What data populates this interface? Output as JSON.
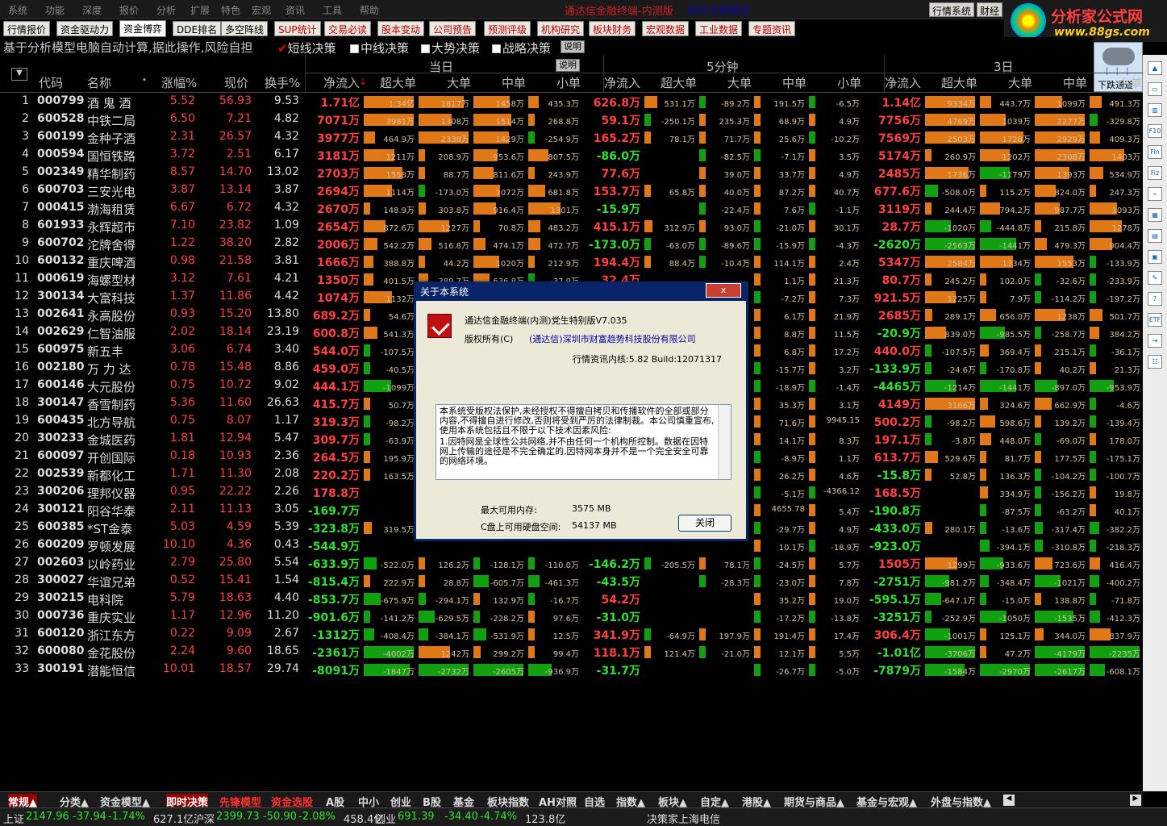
{
  "menu": [
    "系统",
    "功能",
    "深度",
    "报价",
    "分析",
    "扩展",
    "特色",
    "宏观",
    "资讯",
    "工具",
    "帮助"
  ],
  "app_title": "通达信金融终端-内测版",
  "mode_title": "即时决策模型",
  "top_buttons": [
    "行情系统",
    "财经"
  ],
  "logo": {
    "main": "分析家公式网",
    "url": "www.88gs.com"
  },
  "tabs": [
    {
      "label": "行情报价",
      "red": false
    },
    {
      "label": "资金驱动力",
      "red": false
    },
    {
      "label": "资金博弈",
      "red": false
    },
    {
      "label": "DDE排名",
      "red": false
    },
    {
      "label": "多空阵线",
      "red": false
    },
    {
      "label": "SUP统计",
      "red": true
    },
    {
      "label": "交易必读",
      "red": true
    },
    {
      "label": "股本变动",
      "red": true
    },
    {
      "label": "公司预告",
      "red": true
    },
    {
      "label": "预测评级",
      "red": true
    },
    {
      "label": "机构研究",
      "red": true
    },
    {
      "label": "板块财务",
      "red": true
    },
    {
      "label": "宏观数据",
      "red": true
    },
    {
      "label": "工业数据",
      "red": true
    },
    {
      "label": "专题资讯",
      "red": true
    }
  ],
  "notice": {
    "message": "基于分析模型电脑自动计算,据此操作,风险自担",
    "options": [
      {
        "label": "短线决策",
        "checked": true
      },
      {
        "label": "中线决策",
        "checked": false
      },
      {
        "label": "大势决策",
        "checked": false
      },
      {
        "label": "战略决策",
        "checked": false
      }
    ],
    "explain": "说明"
  },
  "weather_label": "下跌通道",
  "groups": {
    "today": "当日",
    "min5": "5分钟",
    "day3": "3日",
    "explain": "说明"
  },
  "cols": {
    "code": "代码",
    "name": "名称",
    "chg": "涨幅%",
    "price": "现价",
    "turn": "换手%",
    "net": "净流入",
    "super": "超大单",
    "large": "大单",
    "mid": "中单",
    "small": "小单"
  },
  "rows": [
    [
      "000799",
      "酒 鬼 酒",
      "5.52",
      "56.93",
      "9.53",
      "1.71亿",
      "1.34亿",
      "1817万",
      "1458万",
      "435.3万",
      "626.8万",
      "531.1万",
      "-89.2万",
      "191.5万",
      "-6.5万",
      "1.14亿",
      "9334万",
      "443.7万",
      "1099万",
      "491.3万"
    ],
    [
      "600528",
      "中铁二局",
      "6.50",
      "7.21",
      "4.82",
      "7071万",
      "3981万",
      "1308万",
      "1514万",
      "268.8万",
      "59.1万",
      "-250.1万",
      "235.3万",
      "68.9万",
      "4.9万",
      "7756万",
      "4769万",
      "1039万",
      "2277万",
      "-329.8万"
    ],
    [
      "600199",
      "金种子酒",
      "2.31",
      "26.57",
      "4.32",
      "3977万",
      "464.9万",
      "2338万",
      "1429万",
      "-254.9万",
      "165.2万",
      "78.1万",
      "71.7万",
      "25.6万",
      "-10.2万",
      "7569万",
      "2503万",
      "1728万",
      "2929万",
      "409.3万"
    ],
    [
      "000594",
      "国恒铁路",
      "3.72",
      "2.51",
      "6.17",
      "3181万",
      "1211万",
      "208.9万",
      "953.6万",
      "807.5万",
      "-86.0万",
      "",
      "-82.5万",
      "-7.1万",
      "3.5万",
      "5174万",
      "260.9万",
      "1202万",
      "2308万",
      "1403万"
    ],
    [
      "002349",
      "精华制药",
      "8.57",
      "14.70",
      "13.02",
      "2703万",
      "1558万",
      "88.7万",
      "811.6万",
      "243.9万",
      "77.6万",
      "",
      "39.0万",
      "33.7万",
      "4.9万",
      "2485万",
      "1736万",
      "-1179万",
      "1393万",
      "534.9万"
    ],
    [
      "600703",
      "三安光电",
      "3.87",
      "13.14",
      "3.87",
      "2694万",
      "1114万",
      "-173.0万",
      "1072万",
      "681.8万",
      "153.7万",
      "65.8万",
      "40.0万",
      "87.2万",
      "40.7万",
      "677.6万",
      "-508.0万",
      "115.2万",
      "824.0万",
      "247.3万"
    ],
    [
      "000415",
      "渤海租赁",
      "6.67",
      "6.72",
      "4.32",
      "2670万",
      "148.9万",
      "303.8万",
      "916.4万",
      "1301万",
      "-15.9万",
      "",
      "-22.4万",
      "7.6万",
      "-1.1万",
      "3119万",
      "244.4万",
      "794.2万",
      "987.7万",
      "1093万"
    ],
    [
      "601933",
      "永辉超市",
      "7.10",
      "23.82",
      "1.09",
      "2654万",
      "872.6万",
      "1227万",
      "70.8万",
      "483.2万",
      "415.1万",
      "312.9万",
      "93.0万",
      "-21.0万",
      "30.1万",
      "28.7万",
      "-1020万",
      "-444.8万",
      "215.8万",
      "1278万"
    ],
    [
      "600702",
      "沱牌舍得",
      "1.22",
      "38.20",
      "2.82",
      "2006万",
      "542.2万",
      "516.8万",
      "474.1万",
      "472.7万",
      "-173.0万",
      "-63.0万",
      "-89.6万",
      "-15.9万",
      "-4.3万",
      "-2620万",
      "-2563万",
      "-1441万",
      "479.3万",
      "904.4万"
    ],
    [
      "600132",
      "重庆啤酒",
      "0.98",
      "21.58",
      "3.81",
      "1666万",
      "388.8万",
      "44.2万",
      "1020万",
      "212.9万",
      "194.4万",
      "88.4万",
      "-10.4万",
      "114.1万",
      "2.4万",
      "5347万",
      "2584万",
      "1334万",
      "1553万",
      "-133.9万"
    ],
    [
      "000619",
      "海螺型材",
      "3.12",
      "7.61",
      "4.21",
      "1350万",
      "401.5万",
      "389.7万",
      "636.8万",
      "-37.9万",
      "32.4万",
      "",
      "",
      "1.1万",
      "21.3万",
      "80.7万",
      "245.2万",
      "102.0万",
      "-32.6万",
      "-233.9万"
    ],
    [
      "300134",
      "大富科技",
      "1.37",
      "11.86",
      "4.42",
      "1074万",
      "1132万",
      "",
      "",
      "",
      "",
      "",
      "",
      "-7.2万",
      "7.3万",
      "921.5万",
      "1225万",
      "7.9万",
      "-114.2万",
      "-197.2万"
    ],
    [
      "002641",
      "永高股份",
      "0.93",
      "15.20",
      "13.80",
      "689.2万",
      "54.6万",
      "",
      "",
      "",
      "",
      "",
      "",
      "6.1万",
      "21.9万",
      "2685万",
      "289.1万",
      "656.0万",
      "1238万",
      "501.7万"
    ],
    [
      "002629",
      "仁智油服",
      "2.02",
      "18.14",
      "23.19",
      "600.8万",
      "541.3万",
      "",
      "",
      "",
      "",
      "",
      "",
      "8.8万",
      "11.5万",
      "-20.9万",
      "839.0万",
      "-985.5万",
      "-258.7万",
      "384.2万"
    ],
    [
      "600975",
      "新五丰",
      "3.06",
      "6.74",
      "3.40",
      "544.0万",
      "-107.5万",
      "",
      "",
      "",
      "",
      "",
      "",
      "6.8万",
      "17.2万",
      "440.0万",
      "-107.5万",
      "369.4万",
      "215.1万",
      "-36.1万"
    ],
    [
      "002180",
      "万 力 达",
      "0.78",
      "15.48",
      "8.86",
      "459.0万",
      "-40.5万",
      "",
      "",
      "",
      "",
      "",
      "",
      "-15.7万",
      "3.2万",
      "-133.9万",
      "-24.6万",
      "-170.8万",
      "40.2万",
      "21.3万"
    ],
    [
      "600146",
      "大元股份",
      "0.75",
      "10.72",
      "9.02",
      "444.1万",
      "-1099万",
      "",
      "",
      "",
      "",
      "",
      "",
      "-18.9万",
      "-1.4万",
      "-4465万",
      "-1214万",
      "-1441万",
      "-897.0万",
      "-953.9万"
    ],
    [
      "300147",
      "香雪制药",
      "5.36",
      "11.60",
      "26.63",
      "415.7万",
      "50.7万",
      "",
      "",
      "",
      "",
      "",
      "",
      "35.3万",
      "3.1万",
      "4149万",
      "3166万",
      "324.6万",
      "662.9万",
      "-4.6万"
    ],
    [
      "600435",
      "北方导航",
      "0.75",
      "8.07",
      "1.17",
      "319.3万",
      "-98.2万",
      "",
      "",
      "",
      "",
      "",
      "",
      "71.6万",
      "9945.15",
      "500.2万",
      "-98.2万",
      "598.6万",
      "139.2万",
      "-139.4万"
    ],
    [
      "300233",
      "金城医药",
      "1.81",
      "12.94",
      "5.47",
      "309.7万",
      "-63.9万",
      "",
      "",
      "",
      "",
      "",
      "",
      "14.1万",
      "8.3万",
      "197.1万",
      "-3.8万",
      "448.0万",
      "-69.0万",
      "178.0万"
    ],
    [
      "600097",
      "开创国际",
      "0.18",
      "10.93",
      "2.36",
      "264.5万",
      "195.9万",
      "",
      "",
      "",
      "",
      "",
      "",
      "-8.9万",
      "1.1万",
      "613.7万",
      "529.6万",
      "81.7万",
      "177.5万",
      "-175.1万"
    ],
    [
      "002539",
      "新都化工",
      "1.71",
      "11.30",
      "2.08",
      "220.2万",
      "163.5万",
      "",
      "",
      "",
      "",
      "",
      "",
      "26.2万",
      "4.6万",
      "-15.8万",
      "52.8万",
      "136.3万",
      "-104.2万",
      "-100.7万"
    ],
    [
      "300206",
      "理邦仪器",
      "0.95",
      "22.22",
      "2.26",
      "178.8万",
      "",
      "",
      "",
      "",
      "",
      "",
      "",
      "-5.1万",
      "-4366.12",
      "168.5万",
      "",
      "334.9万",
      "-156.2万",
      "19.8万"
    ],
    [
      "300121",
      "阳谷华泰",
      "2.11",
      "11.13",
      "3.05",
      "-169.7万",
      "",
      "",
      "",
      "",
      "",
      "",
      "",
      "4655.78",
      "5.4万",
      "-190.8万",
      "",
      "-87.5万",
      "-63.2万",
      "40.1万"
    ],
    [
      "600385",
      "*ST金泰",
      "5.03",
      "4.59",
      "5.39",
      "-323.8万",
      "319.5万",
      "",
      "",
      "",
      "",
      "",
      "",
      "-29.7万",
      "4.9万",
      "-433.0万",
      "280.1万",
      "-13.6万",
      "-317.4万",
      "-382.2万"
    ],
    [
      "600209",
      "罗顿发展",
      "10.10",
      "4.36",
      "0.43",
      "-544.9万",
      "",
      "",
      "",
      "",
      "",
      "",
      "",
      "10.1万",
      "-18.9万",
      "-923.0万",
      "",
      "-394.1万",
      "-310.8万",
      "-218.3万"
    ],
    [
      "002603",
      "以岭药业",
      "2.79",
      "25.80",
      "5.54",
      "-633.9万",
      "-522.0万",
      "126.2万",
      "-128.1万",
      "-110.0万",
      "-146.2万",
      "-205.5万",
      "78.1万",
      "-24.5万",
      "5.7万",
      "1505万",
      "1299万",
      "-933.6万",
      "723.6万",
      "416.4万"
    ],
    [
      "300027",
      "华谊兄弟",
      "0.52",
      "15.41",
      "1.54",
      "-815.4万",
      "222.9万",
      "28.8万",
      "-605.7万",
      "-461.3万",
      "-43.5万",
      "",
      "-28.3万",
      "-23.0万",
      "7.8万",
      "-2751万",
      "-981.2万",
      "-348.4万",
      "-1021万",
      "-400.2万"
    ],
    [
      "300215",
      "电科院",
      "5.79",
      "18.63",
      "4.40",
      "-853.7万",
      "-675.9万",
      "-294.1万",
      "132.9万",
      "-16.7万",
      "54.2万",
      "",
      "",
      "35.2万",
      "19.0万",
      "-595.1万",
      "-647.1万",
      "-15.0万",
      "138.8万",
      "-71.8万"
    ],
    [
      "000736",
      "重庆实业",
      "1.17",
      "12.96",
      "11.20",
      "-901.6万",
      "-141.2万",
      "-629.5万",
      "-228.2万",
      "97.6万",
      "-31.0万",
      "",
      "",
      "-17.2万",
      "-13.8万",
      "-3251万",
      "-252.9万",
      "-1050万",
      "-1535万",
      "-412.3万"
    ],
    [
      "600120",
      "浙江东方",
      "0.22",
      "9.09",
      "2.67",
      "-1312万",
      "-408.4万",
      "-384.1万",
      "-531.9万",
      "12.5万",
      "341.9万",
      "-64.9万",
      "197.9万",
      "191.4万",
      "17.4万",
      "306.4万",
      "-1001万",
      "125.1万",
      "344.0万",
      "837.9万"
    ],
    [
      "600080",
      "金花股份",
      "2.24",
      "9.60",
      "18.65",
      "-2361万",
      "-4002万",
      "1242万",
      "299.2万",
      "99.4万",
      "118.1万",
      "121.4万",
      "-21.0万",
      "12.1万",
      "5.5万",
      "-1.01亿",
      "-3706万",
      "47.2万",
      "-4179万",
      "-2235万"
    ],
    [
      "300191",
      "潜能恒信",
      "10.01",
      "18.57",
      "29.74",
      "-8091万",
      "-1847万",
      "-2732万",
      "-2605万",
      "-936.9万",
      "-31.7万",
      "",
      "",
      "-26.7万",
      "-5.0万",
      "-7879万",
      "-1584万",
      "-2970万",
      "-2617万",
      "-608.1万"
    ]
  ],
  "bottom_tabs": [
    {
      "label": "常规▲",
      "red": true,
      "active": true
    },
    {
      "label": "分类▲"
    },
    {
      "label": "资金模型▲"
    },
    {
      "label": "即时决策",
      "active": true
    },
    {
      "label": "先锋模型",
      "red": true
    },
    {
      "label": "资金选股",
      "red": true
    },
    {
      "label": "A股"
    },
    {
      "label": "中小"
    },
    {
      "label": "创业"
    },
    {
      "label": "B股"
    },
    {
      "label": "基金"
    },
    {
      "label": "板块指数"
    },
    {
      "label": "AH对照"
    },
    {
      "label": "自选"
    },
    {
      "label": "指数▲"
    },
    {
      "label": "板块▲"
    },
    {
      "label": "自定▲"
    },
    {
      "label": "港股▲"
    },
    {
      "label": "期货与商品▲"
    },
    {
      "label": "基金与宏观▲"
    },
    {
      "label": "外盘与指数▲"
    }
  ],
  "status": {
    "sh": {
      "name": "上证",
      "val": "2147.96",
      "chg": "-37.94",
      "pct": "-1.74%",
      "amt": "627.1亿"
    },
    "hs": {
      "name": "沪深",
      "val": "2399.73",
      "chg": "-50.90",
      "pct": "-2.08%",
      "amt": "458.4亿"
    },
    "cy": {
      "name": "创业",
      "val": "691.39",
      "chg": "-34.40",
      "pct": "-4.74%",
      "amt": "123.8亿"
    },
    "server": "决策家上海电信"
  },
  "dialog": {
    "title": "关于本系统",
    "close_x": "x",
    "product": "通达信金融终端(内测)党生特别版V7.035",
    "copyright_label": "版权所有(C)",
    "copyright_owner": "(通达信)深圳市财富趋势科技股份有限公司",
    "kernel": "行情资讯内核:5.82 Build:12071317",
    "text1": "本系统受版权法保护,未经授权不得擅自拷贝和传播软件的全部或部分内容,不得擅自进行修改,否则将受到严厉的法律制裁。本公司慎重宣布,使用本系统包括且不限于以下技术因素风险:",
    "text2": "1.因特网是全球性公共网络,并不由任何一个机构所控制。数据在因特网上传输的途径是不完全确定的,因特网本身并不是一个完全安全可靠的网络环境。",
    "mem_label": "最大可用内存:",
    "mem_val": "3575 MB",
    "disk_label": "C盘上可用硬盘空间:",
    "disk_val": "54137 MB",
    "close_btn": "关闭"
  }
}
